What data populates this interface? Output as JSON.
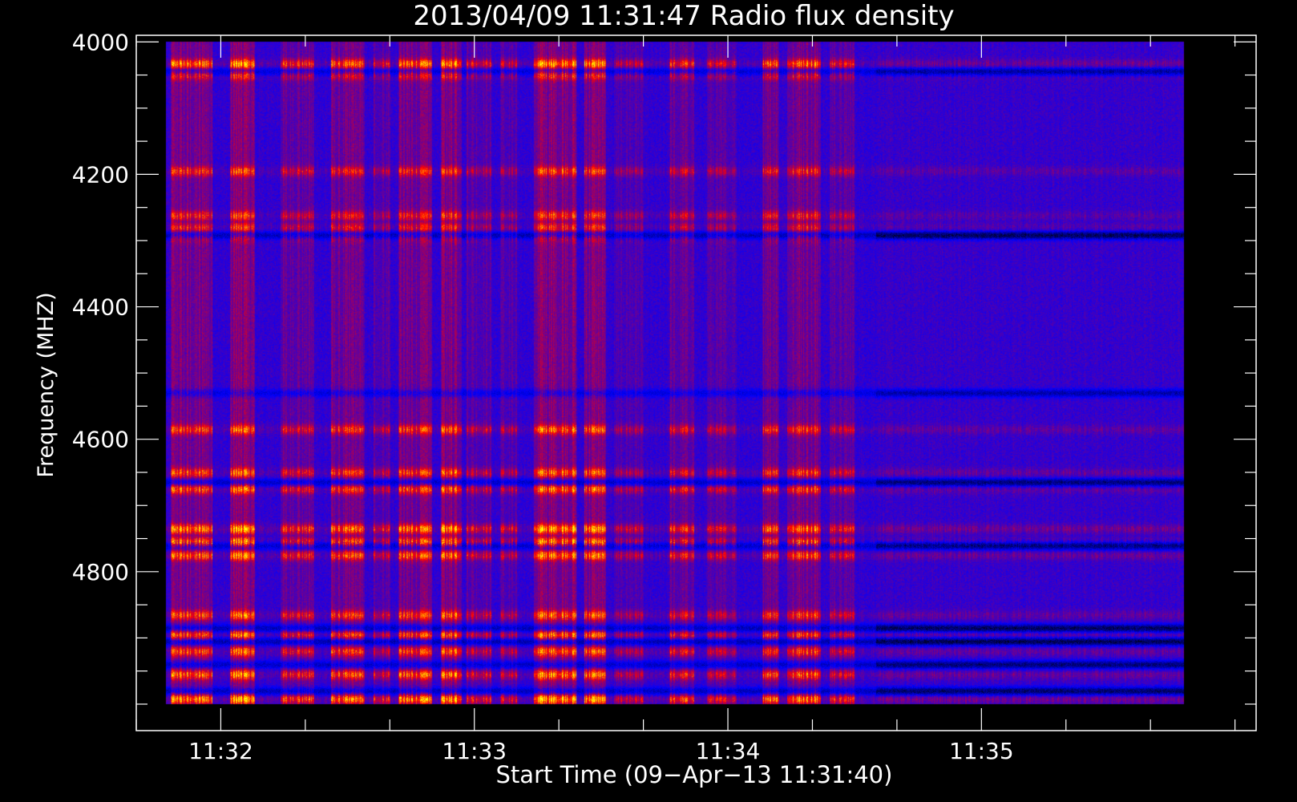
{
  "chart_data": {
    "type": "heatmap",
    "title": "2013/04/09 11:31:47 Radio flux density",
    "xlabel": "Start Time (09−Apr−13 11:31:40)",
    "ylabel": "Frequency (MHZ)",
    "y_axis": {
      "range_mhz": [
        3990,
        5040
      ],
      "inverted": true,
      "major_ticks": [
        4000,
        4200,
        4400,
        4600,
        4800
      ],
      "major_tick_labels": [
        "4000",
        "4200",
        "4400",
        "4600",
        "4800"
      ],
      "minor_step_mhz": 50
    },
    "x_axis": {
      "range": [
        "11:31:40",
        "11:36:05"
      ],
      "major_ticks": [
        "11:32",
        "11:33",
        "11:34",
        "11:35"
      ],
      "minor_step_s": 20
    },
    "data_extent": {
      "time": [
        "11:31:47",
        "11:35:48"
      ],
      "frequency_mhz": [
        4000,
        5000
      ]
    },
    "colormap": [
      "#000000",
      "#0000ff",
      "#ff0000",
      "#ffff00"
    ],
    "colors": {
      "background": "#000000",
      "axes": "#ffffff",
      "baseline": "#0000ff"
    },
    "enhanced_bands_mhz": [
      {
        "center": 4033,
        "strength": 0.9
      },
      {
        "center": 4050,
        "strength": 0.55
      },
      {
        "center": 4195,
        "strength": 0.6
      },
      {
        "center": 4262,
        "strength": 0.55
      },
      {
        "center": 4280,
        "strength": 0.5
      },
      {
        "center": 4295,
        "strength": 0.35
      },
      {
        "center": 4585,
        "strength": 0.7
      },
      {
        "center": 4650,
        "strength": 0.7
      },
      {
        "center": 4675,
        "strength": 0.75
      },
      {
        "center": 4735,
        "strength": 0.95
      },
      {
        "center": 4755,
        "strength": 0.9
      },
      {
        "center": 4775,
        "strength": 0.8
      },
      {
        "center": 4865,
        "strength": 0.7
      },
      {
        "center": 4895,
        "strength": 0.75
      },
      {
        "center": 4920,
        "strength": 0.7
      },
      {
        "center": 4955,
        "strength": 0.8
      },
      {
        "center": 4992,
        "strength": 1.0
      }
    ],
    "dark_bands_mhz": [
      {
        "center": 4045,
        "strength": 0.6
      },
      {
        "center": 4292,
        "strength": 0.85
      },
      {
        "center": 4530,
        "strength": 0.5
      },
      {
        "center": 4665,
        "strength": 0.7
      },
      {
        "center": 4760,
        "strength": 0.75
      },
      {
        "center": 4885,
        "strength": 0.8
      },
      {
        "center": 4905,
        "strength": 0.85
      },
      {
        "center": 4940,
        "strength": 0.7
      },
      {
        "center": 4980,
        "strength": 0.75
      }
    ],
    "active_time_columns": [
      {
        "start": "11:31:48",
        "end": "11:31:58",
        "strength": 0.8
      },
      {
        "start": "11:32:02",
        "end": "11:32:08",
        "strength": 0.9
      },
      {
        "start": "11:32:14",
        "end": "11:32:22",
        "strength": 0.6
      },
      {
        "start": "11:32:26",
        "end": "11:32:34",
        "strength": 0.7
      },
      {
        "start": "11:32:36",
        "end": "11:32:40",
        "strength": 0.5
      },
      {
        "start": "11:32:42",
        "end": "11:32:50",
        "strength": 0.75
      },
      {
        "start": "11:32:52",
        "end": "11:32:57",
        "strength": 0.85
      },
      {
        "start": "11:32:58",
        "end": "11:33:04",
        "strength": 0.5
      },
      {
        "start": "11:33:06",
        "end": "11:33:10",
        "strength": 0.45
      },
      {
        "start": "11:33:14",
        "end": "11:33:24",
        "strength": 0.9
      },
      {
        "start": "11:33:26",
        "end": "11:33:31",
        "strength": 0.85
      },
      {
        "start": "11:33:33",
        "end": "11:33:40",
        "strength": 0.4
      },
      {
        "start": "11:33:46",
        "end": "11:33:52",
        "strength": 0.6
      },
      {
        "start": "11:33:55",
        "end": "11:34:02",
        "strength": 0.45
      },
      {
        "start": "11:34:08",
        "end": "11:34:12",
        "strength": 0.7
      },
      {
        "start": "11:34:14",
        "end": "11:34:22",
        "strength": 0.8
      },
      {
        "start": "11:34:24",
        "end": "11:34:30",
        "strength": 0.5
      }
    ],
    "quiet_period": {
      "start": "11:34:35",
      "end": "11:35:48"
    }
  }
}
